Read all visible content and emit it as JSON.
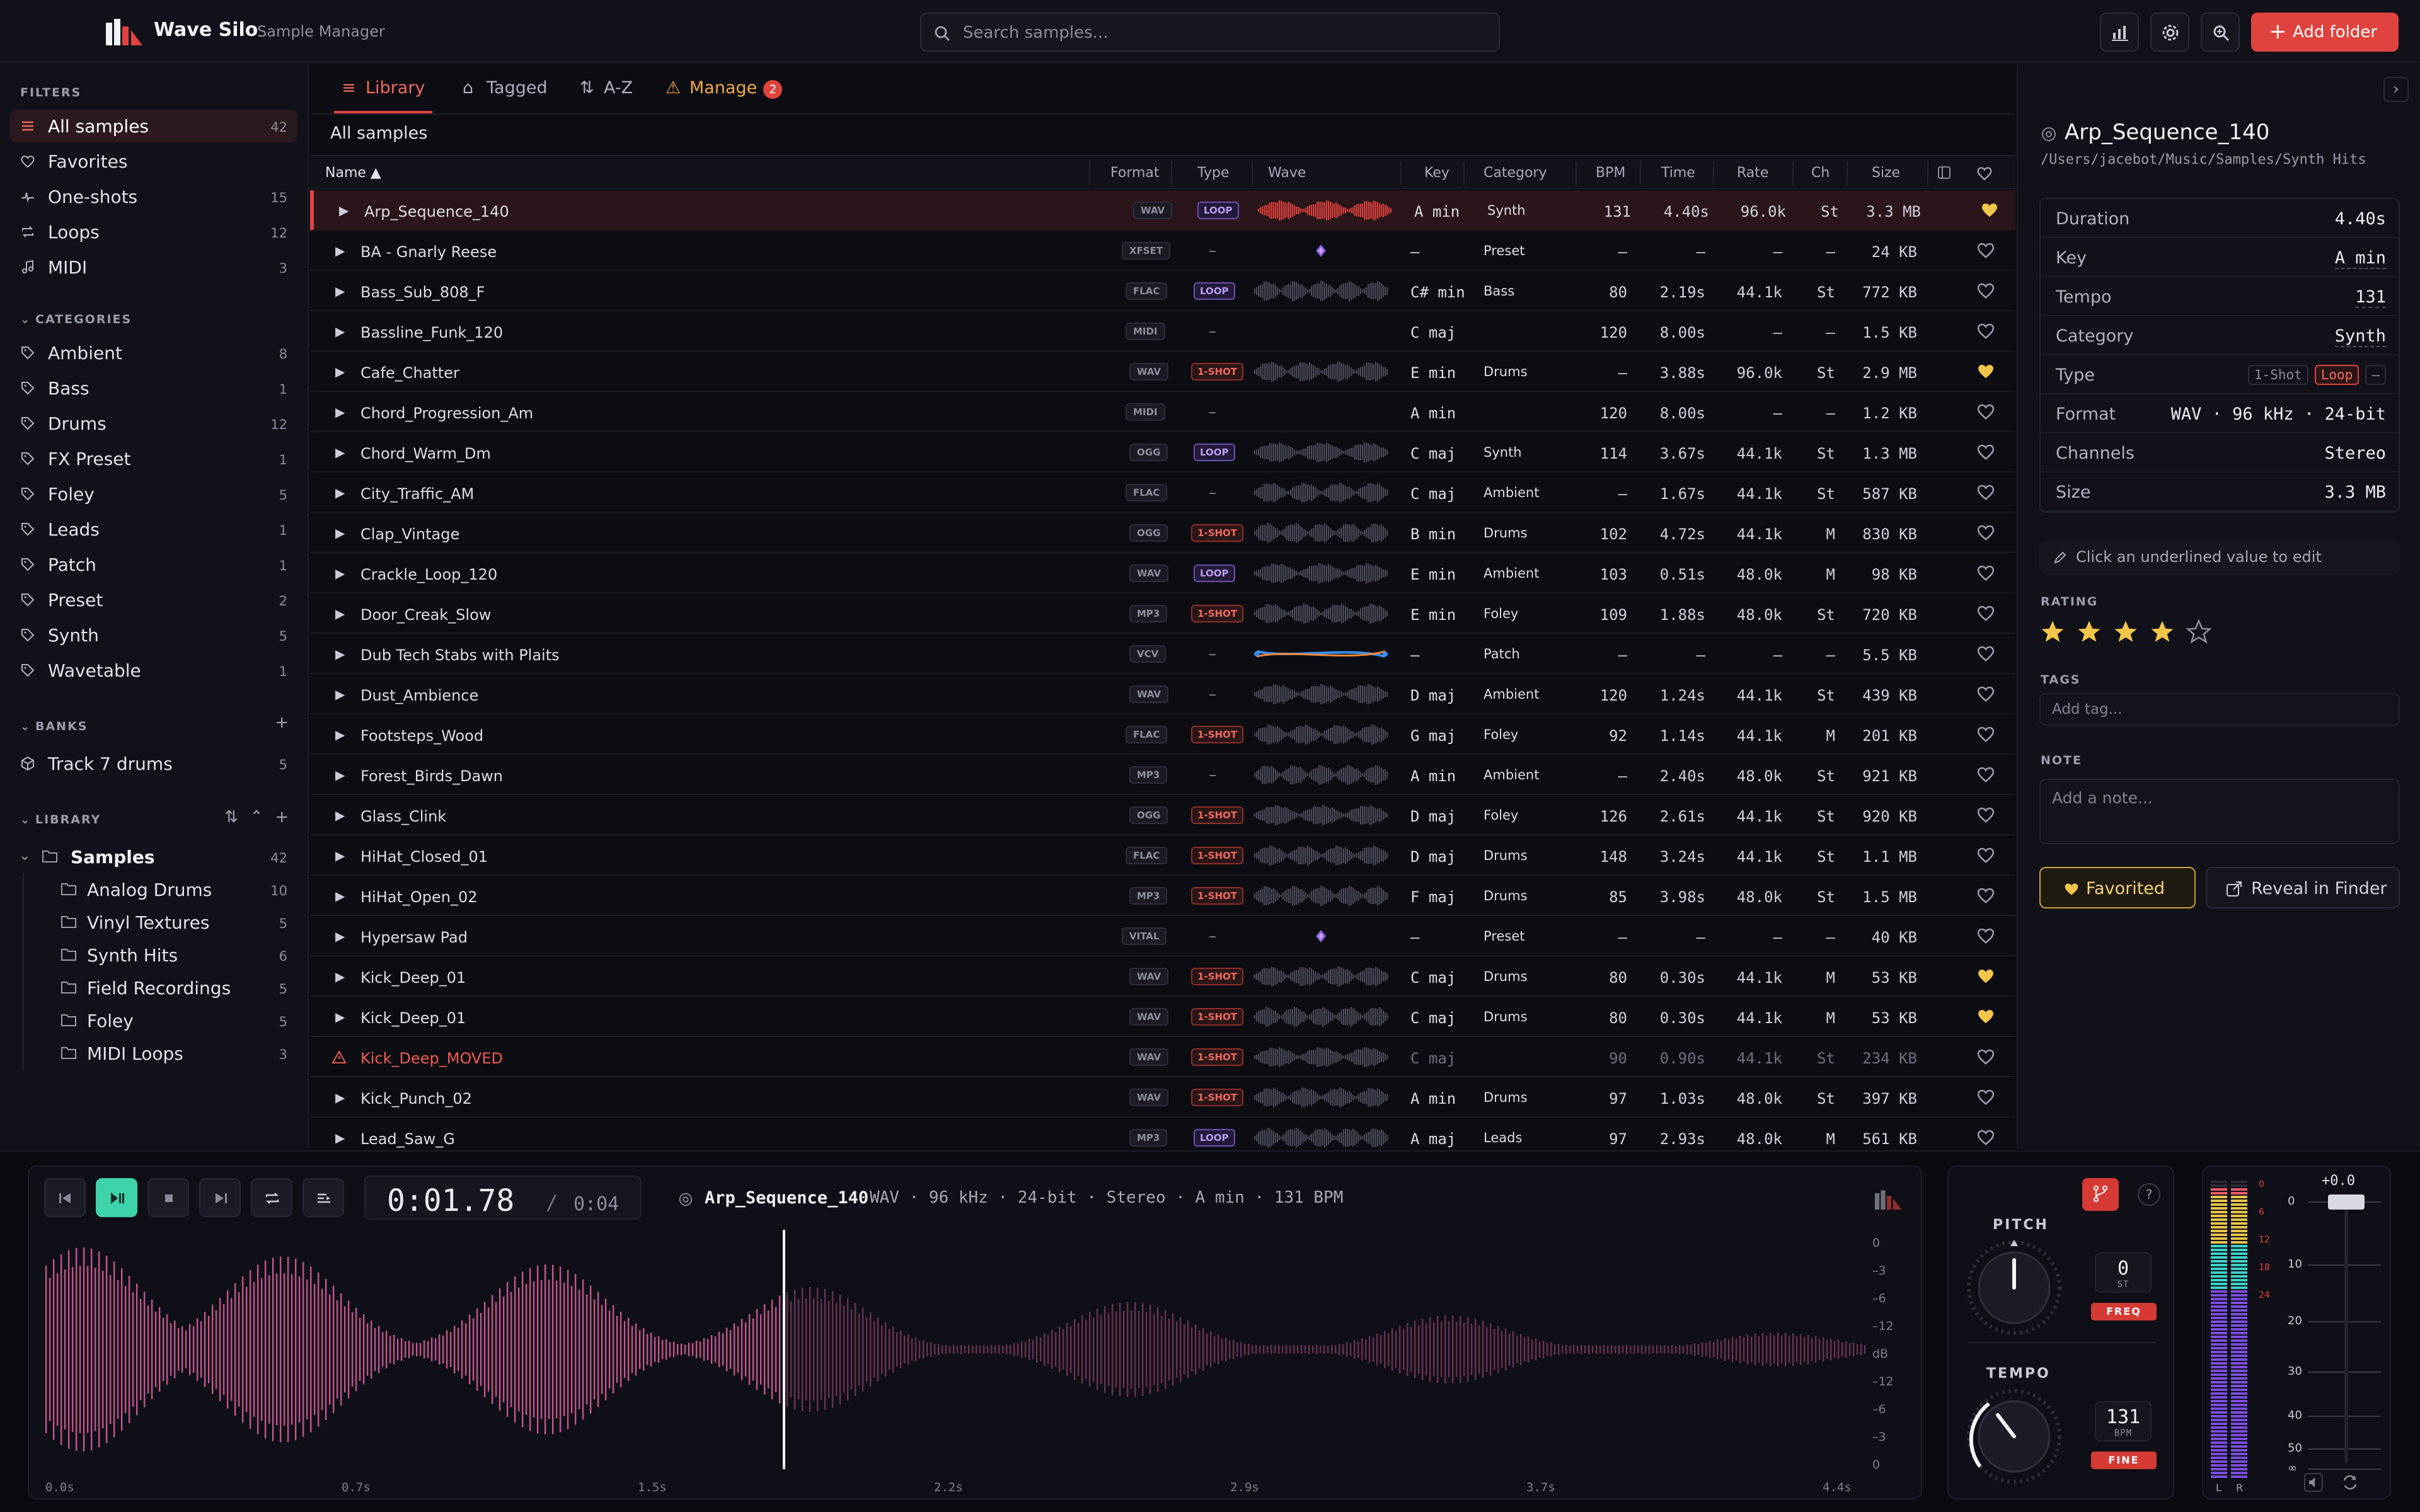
{
  "app": {
    "name": "Wave Silo",
    "subtitle": "Sample Manager"
  },
  "search": {
    "placeholder": "Search samples..."
  },
  "header": {
    "add_folder": "Add folder",
    "icons": [
      "chart-icon",
      "gear-icon",
      "zoom-icon"
    ]
  },
  "sidebar": {
    "filters_title": "FILTERS",
    "filters": [
      {
        "label": "All samples",
        "count": "42",
        "icon": "grid-icon",
        "selected": true
      },
      {
        "label": "Favorites",
        "count": "",
        "icon": "heart-icon"
      },
      {
        "label": "One-shots",
        "count": "15",
        "icon": "oneshot-icon"
      },
      {
        "label": "Loops",
        "count": "12",
        "icon": "loop-icon"
      },
      {
        "label": "MIDI",
        "count": "3",
        "icon": "music-icon"
      }
    ],
    "categories_title": "CATEGORIES",
    "categories": [
      {
        "label": "Ambient",
        "count": "8"
      },
      {
        "label": "Bass",
        "count": "1"
      },
      {
        "label": "Drums",
        "count": "12"
      },
      {
        "label": "FX Preset",
        "count": "1"
      },
      {
        "label": "Foley",
        "count": "5"
      },
      {
        "label": "Leads",
        "count": "1"
      },
      {
        "label": "Patch",
        "count": "1"
      },
      {
        "label": "Preset",
        "count": "2"
      },
      {
        "label": "Synth",
        "count": "5"
      },
      {
        "label": "Wavetable",
        "count": "1"
      }
    ],
    "banks_title": "BANKS",
    "banks": [
      {
        "label": "Track 7 drums",
        "count": "5"
      }
    ],
    "library_title": "LIBRARY",
    "library_root": {
      "label": "Samples",
      "count": "42"
    },
    "library_children": [
      {
        "label": "Analog Drums",
        "count": "10"
      },
      {
        "label": "Vinyl Textures",
        "count": "5"
      },
      {
        "label": "Synth Hits",
        "count": "6"
      },
      {
        "label": "Field Recordings",
        "count": "5"
      },
      {
        "label": "Foley",
        "count": "5"
      },
      {
        "label": "MIDI Loops",
        "count": "3"
      }
    ]
  },
  "tabs": [
    {
      "label": "Library",
      "icon": "list-icon",
      "active": true
    },
    {
      "label": "Tagged",
      "icon": "tag-icon"
    },
    {
      "label": "A-Z",
      "icon": "sort-icon"
    },
    {
      "label": "Manage",
      "icon": "warning-icon",
      "badge": "2"
    }
  ],
  "breadcrumb": "All samples",
  "table": {
    "columns": {
      "name": "Name ▲",
      "format": "Format",
      "type": "Type",
      "wave": "Wave",
      "key": "Key",
      "category": "Category",
      "bpm": "BPM",
      "time": "Time",
      "rate": "Rate",
      "ch": "Ch",
      "size": "Size"
    },
    "rows": [
      {
        "name": "Arp_Sequence_140",
        "format": "WAV",
        "type": "LOOP",
        "key": "A min",
        "category": "Synth",
        "bpm": "131",
        "time": "4.40s",
        "rate": "96.0k",
        "ch": "St",
        "size": "3.3 MB",
        "fav": true,
        "sel": true,
        "wave": "wave"
      },
      {
        "name": "BA - Gnarly Reese",
        "format": "XFSET",
        "type": "–",
        "key": "–",
        "category": "Preset",
        "bpm": "–",
        "time": "–",
        "rate": "–",
        "ch": "–",
        "size": "24 KB",
        "fav": false,
        "wave": "diamond"
      },
      {
        "name": "Bass_Sub_808_F",
        "format": "FLAC",
        "type": "LOOP",
        "key": "C# min",
        "category": "Bass",
        "bpm": "80",
        "time": "2.19s",
        "rate": "44.1k",
        "ch": "St",
        "size": "772 KB",
        "fav": false,
        "wave": "wave"
      },
      {
        "name": "Bassline_Funk_120",
        "format": "MIDI",
        "type": "–",
        "key": "C maj",
        "category": "",
        "bpm": "120",
        "time": "8.00s",
        "rate": "–",
        "ch": "–",
        "size": "1.5 KB",
        "fav": false,
        "wave": "none"
      },
      {
        "name": "Cafe_Chatter",
        "format": "WAV",
        "type": "1-SHOT",
        "key": "E min",
        "category": "Drums",
        "bpm": "–",
        "time": "3.88s",
        "rate": "96.0k",
        "ch": "St",
        "size": "2.9 MB",
        "fav": true,
        "wave": "wave"
      },
      {
        "name": "Chord_Progression_Am",
        "format": "MIDI",
        "type": "–",
        "key": "A min",
        "category": "",
        "bpm": "120",
        "time": "8.00s",
        "rate": "–",
        "ch": "–",
        "size": "1.2 KB",
        "fav": false,
        "wave": "none"
      },
      {
        "name": "Chord_Warm_Dm",
        "format": "OGG",
        "type": "LOOP",
        "key": "C maj",
        "category": "Synth",
        "bpm": "114",
        "time": "3.67s",
        "rate": "44.1k",
        "ch": "St",
        "size": "1.3 MB",
        "fav": false,
        "wave": "wave"
      },
      {
        "name": "City_Traffic_AM",
        "format": "FLAC",
        "type": "–",
        "key": "C maj",
        "category": "Ambient",
        "bpm": "–",
        "time": "1.67s",
        "rate": "44.1k",
        "ch": "St",
        "size": "587 KB",
        "fav": false,
        "wave": "wave"
      },
      {
        "name": "Clap_Vintage",
        "format": "OGG",
        "type": "1-SHOT",
        "key": "B min",
        "category": "Drums",
        "bpm": "102",
        "time": "4.72s",
        "rate": "44.1k",
        "ch": "M",
        "size": "830 KB",
        "fav": false,
        "wave": "wave"
      },
      {
        "name": "Crackle_Loop_120",
        "format": "WAV",
        "type": "LOOP",
        "key": "E min",
        "category": "Ambient",
        "bpm": "103",
        "time": "0.51s",
        "rate": "48.0k",
        "ch": "M",
        "size": "98 KB",
        "fav": false,
        "wave": "wave"
      },
      {
        "name": "Door_Creak_Slow",
        "format": "MP3",
        "type": "1-SHOT",
        "key": "E min",
        "category": "Foley",
        "bpm": "109",
        "time": "1.88s",
        "rate": "48.0k",
        "ch": "St",
        "size": "720 KB",
        "fav": false,
        "wave": "wave"
      },
      {
        "name": "Dub Tech Stabs with Plaits",
        "format": "VCV",
        "type": "–",
        "key": "–",
        "category": "Patch",
        "bpm": "–",
        "time": "–",
        "rate": "–",
        "ch": "–",
        "size": "5.5 KB",
        "fav": false,
        "wave": "patch"
      },
      {
        "name": "Dust_Ambience",
        "format": "WAV",
        "type": "–",
        "key": "D maj",
        "category": "Ambient",
        "bpm": "120",
        "time": "1.24s",
        "rate": "44.1k",
        "ch": "St",
        "size": "439 KB",
        "fav": false,
        "wave": "wave"
      },
      {
        "name": "Footsteps_Wood",
        "format": "FLAC",
        "type": "1-SHOT",
        "key": "G maj",
        "category": "Foley",
        "bpm": "92",
        "time": "1.14s",
        "rate": "44.1k",
        "ch": "M",
        "size": "201 KB",
        "fav": false,
        "wave": "wave"
      },
      {
        "name": "Forest_Birds_Dawn",
        "format": "MP3",
        "type": "–",
        "key": "A min",
        "category": "Ambient",
        "bpm": "–",
        "time": "2.40s",
        "rate": "48.0k",
        "ch": "St",
        "size": "921 KB",
        "fav": false,
        "wave": "wave"
      },
      {
        "name": "Glass_Clink",
        "format": "OGG",
        "type": "1-SHOT",
        "key": "D maj",
        "category": "Foley",
        "bpm": "126",
        "time": "2.61s",
        "rate": "44.1k",
        "ch": "St",
        "size": "920 KB",
        "fav": false,
        "wave": "wave"
      },
      {
        "name": "HiHat_Closed_01",
        "format": "FLAC",
        "type": "1-SHOT",
        "key": "D maj",
        "category": "Drums",
        "bpm": "148",
        "time": "3.24s",
        "rate": "44.1k",
        "ch": "St",
        "size": "1.1 MB",
        "fav": false,
        "wave": "wave"
      },
      {
        "name": "HiHat_Open_02",
        "format": "MP3",
        "type": "1-SHOT",
        "key": "F maj",
        "category": "Drums",
        "bpm": "85",
        "time": "3.98s",
        "rate": "48.0k",
        "ch": "St",
        "size": "1.5 MB",
        "fav": false,
        "wave": "wave"
      },
      {
        "name": "Hypersaw Pad",
        "format": "VITAL",
        "type": "–",
        "key": "–",
        "category": "Preset",
        "bpm": "–",
        "time": "–",
        "rate": "–",
        "ch": "–",
        "size": "40 KB",
        "fav": false,
        "wave": "diamond"
      },
      {
        "name": "Kick_Deep_01",
        "format": "WAV",
        "type": "1-SHOT",
        "key": "C maj",
        "category": "Drums",
        "bpm": "80",
        "time": "0.30s",
        "rate": "44.1k",
        "ch": "M",
        "size": "53 KB",
        "fav": true,
        "wave": "wave"
      },
      {
        "name": "Kick_Deep_01",
        "format": "WAV",
        "type": "1-SHOT",
        "key": "C maj",
        "category": "Drums",
        "bpm": "80",
        "time": "0.30s",
        "rate": "44.1k",
        "ch": "M",
        "size": "53 KB",
        "fav": true,
        "wave": "wave"
      },
      {
        "name": "Kick_Deep_MOVED",
        "format": "WAV",
        "type": "1-SHOT",
        "key": "C maj",
        "category": "",
        "bpm": "90",
        "time": "0.90s",
        "rate": "44.1k",
        "ch": "St",
        "size": "234 KB",
        "fav": false,
        "missing": true,
        "wave": "wave"
      },
      {
        "name": "Kick_Punch_02",
        "format": "WAV",
        "type": "1-SHOT",
        "key": "A min",
        "category": "Drums",
        "bpm": "97",
        "time": "1.03s",
        "rate": "48.0k",
        "ch": "St",
        "size": "397 KB",
        "fav": false,
        "wave": "wave"
      },
      {
        "name": "Lead_Saw_G",
        "format": "MP3",
        "type": "LOOP",
        "key": "A maj",
        "category": "Leads",
        "bpm": "97",
        "time": "2.93s",
        "rate": "48.0k",
        "ch": "M",
        "size": "561 KB",
        "fav": false,
        "wave": "wave"
      }
    ]
  },
  "detail": {
    "title": "Arp_Sequence_140",
    "path": "/Users/jacebot/Music/Samples/Synth Hits",
    "props": [
      {
        "k": "Duration",
        "v": "4.40s"
      },
      {
        "k": "Key",
        "v": "A min",
        "editable": true
      },
      {
        "k": "Tempo",
        "v": "131",
        "editable": true
      },
      {
        "k": "Category",
        "v": "Synth",
        "editable": true
      }
    ],
    "type_label": "Type",
    "type_options": [
      "1-Shot",
      "Loop",
      "–"
    ],
    "type_selected": "Loop",
    "props2": [
      {
        "k": "Format",
        "v": "WAV · 96 kHz · 24-bit"
      },
      {
        "k": "Channels",
        "v": "Stereo"
      },
      {
        "k": "Size",
        "v": "3.3 MB"
      }
    ],
    "hint": "Click an underlined value to edit",
    "rating_label": "RATING",
    "rating": 4,
    "rating_max": 5,
    "tags_label": "TAGS",
    "tags_placeholder": "Add tag...",
    "note_label": "NOTE",
    "note_placeholder": "Add a note...",
    "favorited": "Favorited",
    "reveal": "Reveal in Finder"
  },
  "player": {
    "time_current": "0:01.78",
    "time_sep": "/",
    "time_total": "0:04",
    "name": "Arp_Sequence_140",
    "meta": "WAV · 96 kHz · 24-bit · Stereo · A min · 131 BPM",
    "db_labels": [
      "0",
      "–3",
      "–6",
      "–12",
      "dB",
      "–12",
      "–6",
      "–3",
      "0"
    ],
    "time_labels": [
      "0.0s",
      "0.7s",
      "1.5s",
      "2.2s",
      "2.9s",
      "3.7s",
      "4.4s"
    ],
    "progress": 0.405
  },
  "pitch": {
    "label": "PITCH",
    "value": "0",
    "unit": "ST",
    "button": "FREQ"
  },
  "tempo": {
    "label": "TEMPO",
    "value": "131",
    "unit": "BPM",
    "button": "FINE"
  },
  "meter": {
    "volume": "+0.0",
    "scale": [
      "0",
      "10",
      "20",
      "30",
      "40",
      "50",
      "∞"
    ],
    "ticks": [
      "0",
      "6",
      "12",
      "18",
      "24"
    ],
    "channels": [
      "L",
      "R"
    ]
  },
  "colors": {
    "accent": "#e0433d",
    "play": "#3ed3a8",
    "loop": "#b79cf2",
    "favorite": "#f3c64b"
  }
}
